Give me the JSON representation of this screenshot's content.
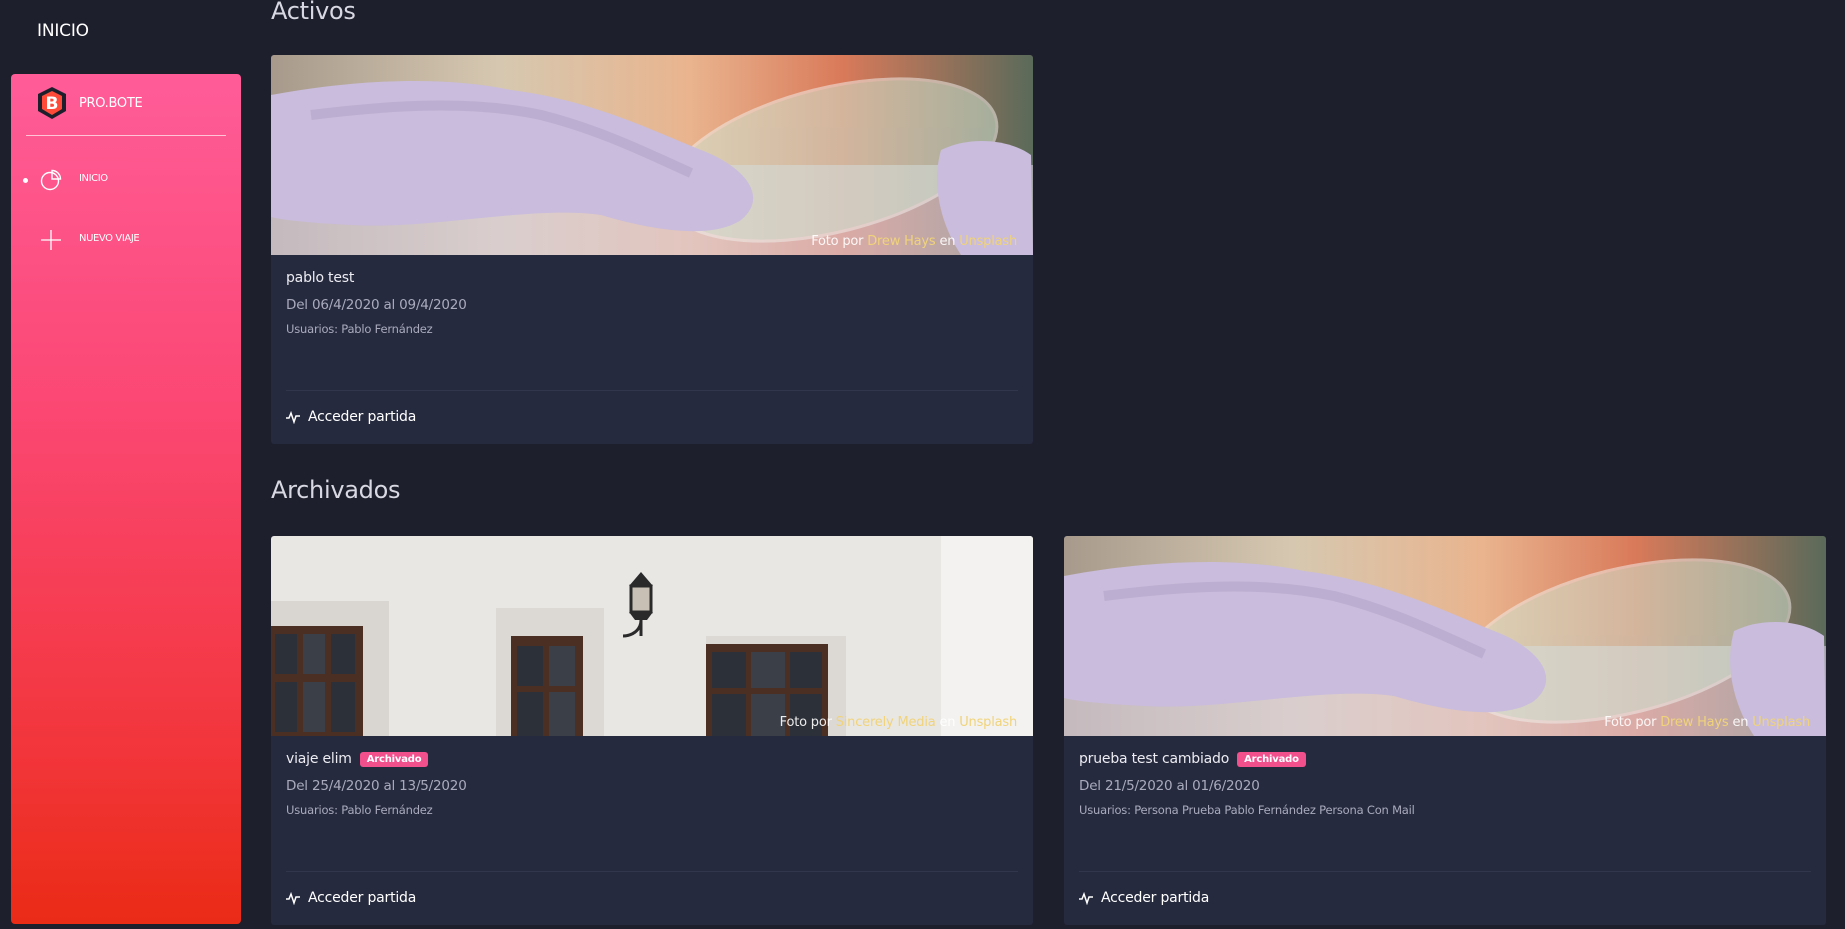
{
  "topbar": {
    "title": "INICIO"
  },
  "sidebar": {
    "brand": {
      "name": "PRO.BOTE",
      "logo_letter": "B"
    },
    "items": [
      {
        "label": "INICIO",
        "icon": "pie-chart-icon",
        "active": true
      },
      {
        "label": "NUEVO VIAJE",
        "icon": "plus-icon",
        "active": false
      }
    ]
  },
  "sections": {
    "active": {
      "title": "Activos"
    },
    "archived": {
      "title": "Archivados"
    }
  },
  "cards": [
    {
      "title": "pablo test",
      "badge": "",
      "dates": "Del 06/4/2020 al 09/4/2020",
      "users": "Usuarios: Pablo Fernández",
      "action": "Acceder partida",
      "image": "gloved-hand-petri-dish",
      "credit": {
        "prefix": "Foto por",
        "author": "Drew Hays",
        "middle": "en",
        "site": "Unsplash"
      }
    },
    {
      "title": "viaje elim",
      "badge": "Archivado",
      "dates": "Del 25/4/2020 al 13/5/2020",
      "users": "Usuarios: Pablo Fernández",
      "action": "Acceder partida",
      "image": "white-wall-windows-lamp",
      "credit": {
        "prefix": "Foto por",
        "author": "Sincerely Media",
        "middle": "en",
        "site": "Unsplash"
      }
    },
    {
      "title": "prueba test cambiado",
      "badge": "Archivado",
      "dates": "Del 21/5/2020 al 01/6/2020",
      "users": "Usuarios: Persona Prueba Pablo Fernández Persona Con Mail",
      "action": "Acceder partida",
      "image": "gloved-hand-petri-dish",
      "credit": {
        "prefix": "Foto por",
        "author": "Drew Hays",
        "middle": "en",
        "site": "Unsplash"
      }
    }
  ],
  "colors": {
    "background": "#1e1f2d",
    "card": "#262a3e",
    "sidebar_top": "#ff5c98",
    "sidebar_bottom": "#ea2b16",
    "badge": "#f24f8d",
    "credit_link": "#f0d37a"
  }
}
